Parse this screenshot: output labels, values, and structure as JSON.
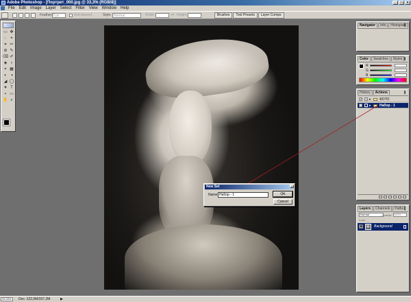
{
  "window": {
    "title": "Adobe Photoshop - [Портрет_000.jpg @ 33,3% (RGB/8)]",
    "controls": [
      "_",
      "□",
      "×"
    ]
  },
  "menu": [
    "File",
    "Edit",
    "Image",
    "Layer",
    "Select",
    "Filter",
    "View",
    "Window",
    "Help"
  ],
  "options_bar": {
    "feather_label": "Feather:",
    "feather_value": "0 px",
    "antialias_label": "Anti-aliased",
    "style_label": "Style:",
    "style_value": "Normal",
    "width_label": "Width:",
    "height_label": "Height:",
    "palette_well_tabs": [
      "Brushes",
      "Tool Presets",
      "Layer Comps"
    ]
  },
  "toolbox": {
    "tools": [
      "▭",
      "✥",
      "◌",
      "⌖",
      "⌗",
      "✂",
      "⊘",
      "✎",
      "⌫",
      "✐",
      "◈",
      "♁",
      "⌖",
      "▦",
      "◐",
      "◑",
      "◢",
      "◯",
      "✦",
      "T",
      "⬩",
      "▭",
      "✋",
      "⌕"
    ]
  },
  "palettes": {
    "navigator": {
      "tabs": [
        "Navigator",
        "Info",
        "Histogram"
      ]
    },
    "color": {
      "tabs": [
        "Color",
        "Swatches",
        "Styles"
      ],
      "sliders": [
        {
          "label": "R",
          "value": "",
          "gradient": "#000000,#ff0000"
        },
        {
          "label": "G",
          "value": "",
          "gradient": "#000000,#00ff00"
        },
        {
          "label": "B",
          "value": "",
          "gradient": "#000000,#0000ff"
        }
      ]
    },
    "actions": {
      "tabs": [
        "History",
        "Actions"
      ],
      "rows": [
        {
          "name": "ФОТО",
          "selected": false
        },
        {
          "name": "Набор - 1",
          "selected": true
        }
      ]
    },
    "layers": {
      "tabs": [
        "Layers",
        "Channels",
        "Paths"
      ],
      "blend_mode": "Normal",
      "opacity_label": "Opacity:",
      "opacity_value": "100%",
      "lock_label": "Lock:",
      "layer_name": "Background"
    }
  },
  "dialog": {
    "title": "New Set",
    "name_label": "Name:",
    "name_value": "Набор - 1",
    "ok_label": "OK",
    "cancel_label": "Cancel",
    "close_glyph": "×"
  },
  "status": {
    "zoom": "33.33%",
    "doc": "Doc: 222,0M/337,2M",
    "arrow": "▶"
  },
  "colors": {
    "accent": "#0a246a",
    "connector": "#a31e1e",
    "chrome": "#d4d0c8"
  }
}
